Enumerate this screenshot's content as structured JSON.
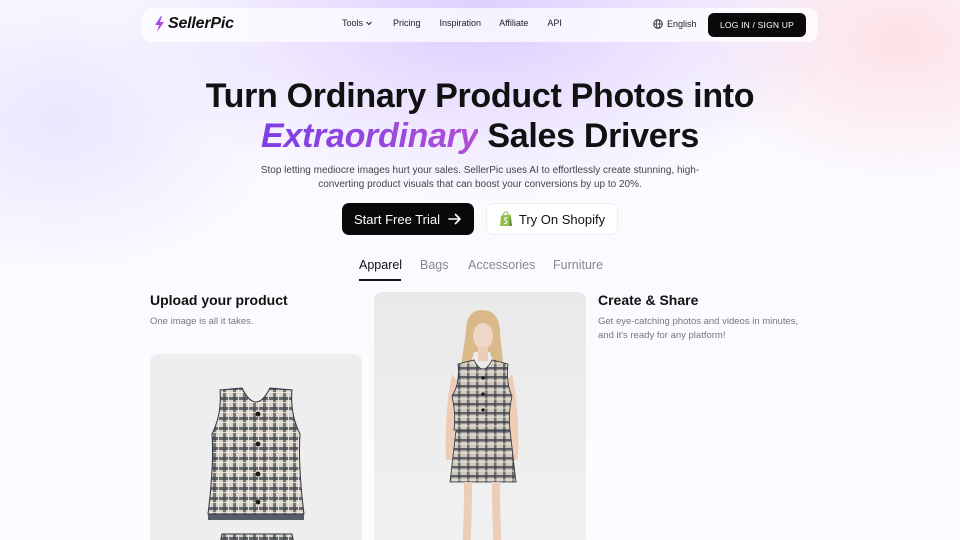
{
  "nav": {
    "logo_text": "SellerPic",
    "menu": [
      "Tools",
      "Pricing",
      "Inspiration",
      "Affiliate",
      "API"
    ],
    "language": "English",
    "login_label": "LOG IN / SIGN UP"
  },
  "hero": {
    "title_line1": "Turn Ordinary Product Photos into",
    "title_accent": "Extraordinary",
    "title_rest": " Sales Drivers",
    "subtitle": "Stop letting mediocre images hurt your sales. SellerPic uses AI to effortlessly create stunning, high-converting product visuals that can boost your conversions by up to 20%.",
    "cta_primary": "Start Free Trial",
    "cta_secondary": "Try On Shopify"
  },
  "tabs": [
    {
      "label": "Apparel",
      "active": true
    },
    {
      "label": "Bags",
      "active": false
    },
    {
      "label": "Accessories",
      "active": false
    },
    {
      "label": "Furniture",
      "active": false
    }
  ],
  "steps": {
    "upload": {
      "title": "Upload your product",
      "desc": "One image is all it takes."
    },
    "create": {
      "title": "Create & Share",
      "desc": "Get eye-catching photos and videos in minutes, and it's ready for any platform!"
    }
  },
  "colors": {
    "accent_start": "#7b3fe4",
    "accent_end": "#b04fd8",
    "primary_button": "#0a0a0a",
    "shopify_green": "#95bf47"
  },
  "icons": {
    "logo": "lightning-bolt-icon",
    "tools_dropdown": "chevron-down-icon",
    "language": "globe-icon",
    "cta_primary": "arrow-right-icon",
    "cta_secondary": "shopify-bag-icon"
  }
}
